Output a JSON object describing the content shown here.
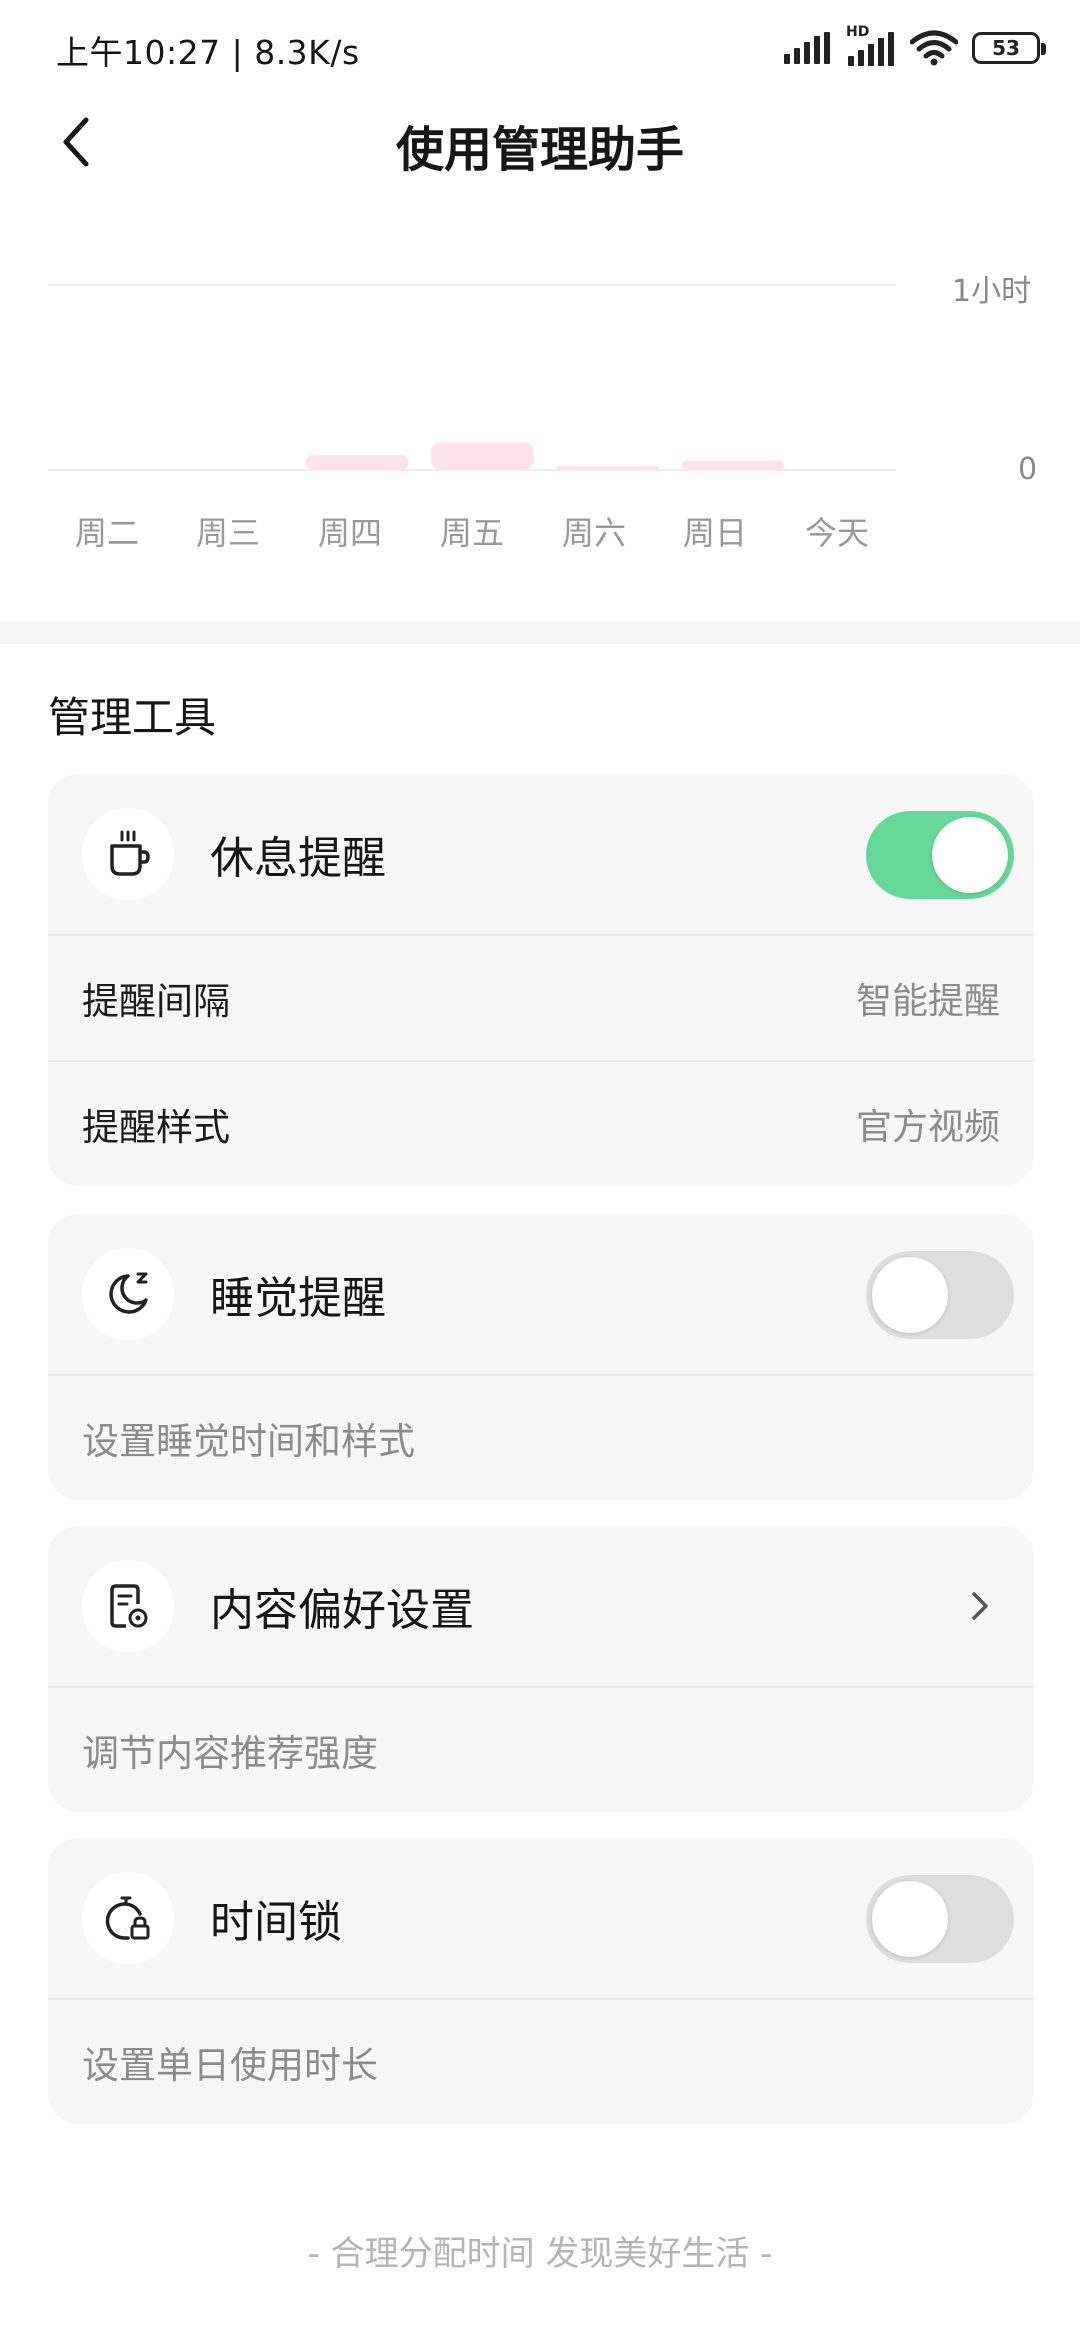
{
  "status_bar": {
    "time": "上午10:27 | 8.3K/s",
    "battery": "53",
    "hd_label": "HD"
  },
  "header": {
    "title": "使用管理助手"
  },
  "chart_data": {
    "type": "bar",
    "categories": [
      "周二",
      "周三",
      "周四",
      "周五",
      "周六",
      "周日",
      "今天"
    ],
    "values": [
      0,
      0,
      0.08,
      0.15,
      0.02,
      0.05,
      0
    ],
    "ylim": [
      0,
      1
    ],
    "ytick_labels": [
      "0",
      "1小时"
    ],
    "bar_color": "#fde3e8",
    "grid": true
  },
  "section": {
    "title": "管理工具"
  },
  "cards": {
    "rest": {
      "title": "休息提醒",
      "icon": "coffee-cup-icon",
      "enabled": true,
      "rows": [
        {
          "label": "提醒间隔",
          "value": "智能提醒"
        },
        {
          "label": "提醒样式",
          "value": "官方视频"
        }
      ]
    },
    "sleep": {
      "title": "睡觉提醒",
      "icon": "moon-sleep-icon",
      "enabled": false,
      "desc": "设置睡觉时间和样式"
    },
    "content": {
      "title": "内容偏好设置",
      "icon": "document-settings-icon",
      "desc": "调节内容推荐强度"
    },
    "timelock": {
      "title": "时间锁",
      "icon": "timer-lock-icon",
      "enabled": false,
      "desc": "设置单日使用时长"
    }
  },
  "colors": {
    "toggle_on": "#66d99a",
    "toggle_off": "#dedede",
    "card_bg": "#f7f7f7"
  },
  "footer": {
    "text": "- 合理分配时间 发现美好生活 -"
  }
}
